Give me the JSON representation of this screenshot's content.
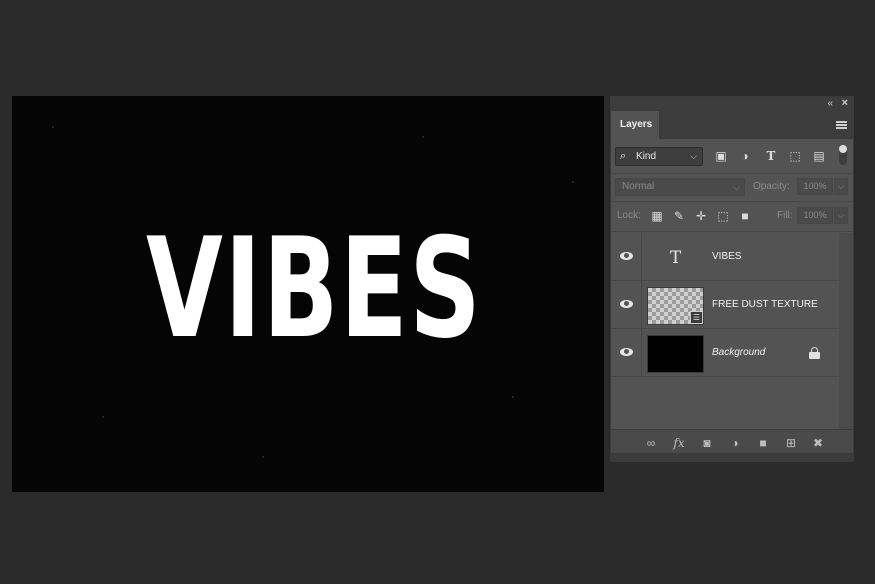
{
  "canvas": {
    "text": "VIBES",
    "background": "#050505",
    "text_color": "#ffffff"
  },
  "panel": {
    "collapse_glyph": "«",
    "close_glyph": "×",
    "tab_label": "Layers",
    "filter": {
      "kind_label": "Kind",
      "icons": [
        "image-filter-icon",
        "adjustment-filter-icon",
        "type-filter-icon",
        "shape-filter-icon",
        "smart-object-filter-icon"
      ]
    },
    "blend_mode": "Normal",
    "opacity_label": "Opacity:",
    "opacity_value": "100%",
    "lock_label": "Lock:",
    "fill_label": "Fill:",
    "fill_value": "100%",
    "layers": [
      {
        "name": "VIBES",
        "thumb": "type",
        "thumb_glyph": "T"
      },
      {
        "name": "FREE DUST TEXTURE",
        "thumb": "transparent"
      },
      {
        "name": "Background",
        "thumb": "black",
        "italic": true,
        "locked": true
      }
    ],
    "bottom_icons": [
      "link-layers-icon",
      "fx-icon",
      "layer-mask-icon",
      "adjustment-layer-icon",
      "group-folder-icon",
      "new-layer-icon",
      "trash-icon"
    ],
    "fx_label": "fx"
  },
  "colors": {
    "app_bg": "#2a2a2a",
    "panel_bg": "#535353",
    "panel_dark": "#3c3c3c"
  }
}
